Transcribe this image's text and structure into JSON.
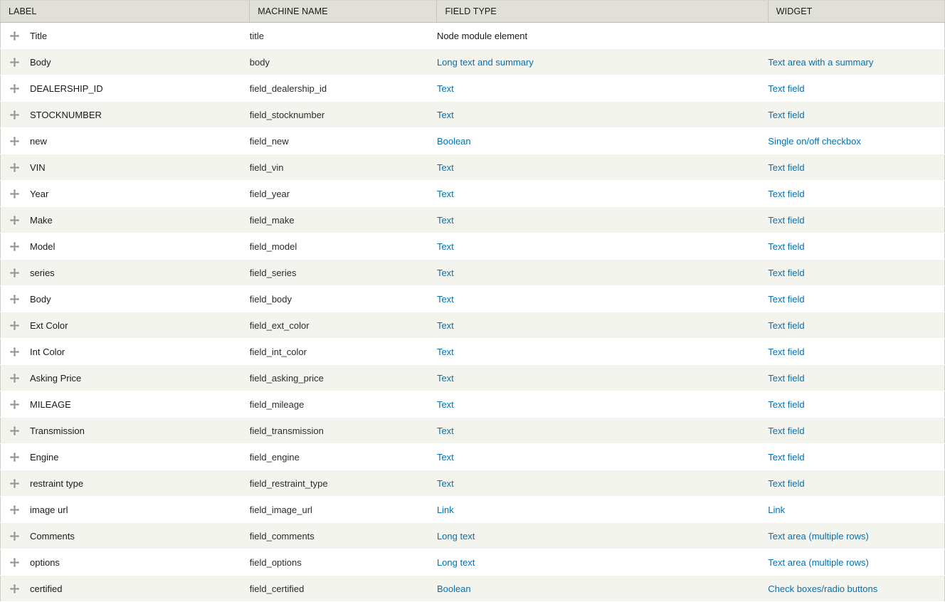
{
  "colors": {
    "header_bg": "#e0e0d9",
    "row_odd_bg": "#ffffff",
    "row_even_bg": "#f4f4ef",
    "link": "#0071b3",
    "text": "#1a1a1a",
    "border": "#c5c5bd"
  },
  "table": {
    "name": "manage-fields-table",
    "columns": [
      {
        "key": "label",
        "header": "LABEL"
      },
      {
        "key": "machine",
        "header": "MACHINE NAME"
      },
      {
        "key": "type",
        "header": "FIELD TYPE"
      },
      {
        "key": "widget",
        "header": "WIDGET"
      }
    ],
    "drag_icon": "move-cross-icon",
    "rows": [
      {
        "label": "Title",
        "machine_name": "title",
        "field_type": "Node module element",
        "field_type_is_link": false,
        "widget": "",
        "widget_is_link": false
      },
      {
        "label": "Body",
        "machine_name": "body",
        "field_type": "Long text and summary",
        "field_type_is_link": true,
        "widget": "Text area with a summary",
        "widget_is_link": true
      },
      {
        "label": "DEALERSHIP_ID",
        "machine_name": "field_dealership_id",
        "field_type": "Text",
        "field_type_is_link": true,
        "widget": "Text field",
        "widget_is_link": true
      },
      {
        "label": "STOCKNUMBER",
        "machine_name": "field_stocknumber",
        "field_type": "Text",
        "field_type_is_link": true,
        "widget": "Text field",
        "widget_is_link": true
      },
      {
        "label": "new",
        "machine_name": "field_new",
        "field_type": "Boolean",
        "field_type_is_link": true,
        "widget": "Single on/off checkbox",
        "widget_is_link": true
      },
      {
        "label": "VIN",
        "machine_name": "field_vin",
        "field_type": "Text",
        "field_type_is_link": true,
        "widget": "Text field",
        "widget_is_link": true
      },
      {
        "label": "Year",
        "machine_name": "field_year",
        "field_type": "Text",
        "field_type_is_link": true,
        "widget": "Text field",
        "widget_is_link": true
      },
      {
        "label": "Make",
        "machine_name": "field_make",
        "field_type": "Text",
        "field_type_is_link": true,
        "widget": "Text field",
        "widget_is_link": true
      },
      {
        "label": "Model",
        "machine_name": "field_model",
        "field_type": "Text",
        "field_type_is_link": true,
        "widget": "Text field",
        "widget_is_link": true
      },
      {
        "label": "series",
        "machine_name": "field_series",
        "field_type": "Text",
        "field_type_is_link": true,
        "widget": "Text field",
        "widget_is_link": true
      },
      {
        "label": "Body",
        "machine_name": "field_body",
        "field_type": "Text",
        "field_type_is_link": true,
        "widget": "Text field",
        "widget_is_link": true
      },
      {
        "label": "Ext Color",
        "machine_name": "field_ext_color",
        "field_type": "Text",
        "field_type_is_link": true,
        "widget": "Text field",
        "widget_is_link": true
      },
      {
        "label": "Int Color",
        "machine_name": "field_int_color",
        "field_type": "Text",
        "field_type_is_link": true,
        "widget": "Text field",
        "widget_is_link": true
      },
      {
        "label": "Asking Price",
        "machine_name": "field_asking_price",
        "field_type": "Text",
        "field_type_is_link": true,
        "widget": "Text field",
        "widget_is_link": true
      },
      {
        "label": "MILEAGE",
        "machine_name": "field_mileage",
        "field_type": "Text",
        "field_type_is_link": true,
        "widget": "Text field",
        "widget_is_link": true
      },
      {
        "label": "Transmission",
        "machine_name": "field_transmission",
        "field_type": "Text",
        "field_type_is_link": true,
        "widget": "Text field",
        "widget_is_link": true
      },
      {
        "label": "Engine",
        "machine_name": "field_engine",
        "field_type": "Text",
        "field_type_is_link": true,
        "widget": "Text field",
        "widget_is_link": true
      },
      {
        "label": "restraint type",
        "machine_name": "field_restraint_type",
        "field_type": "Text",
        "field_type_is_link": true,
        "widget": "Text field",
        "widget_is_link": true
      },
      {
        "label": "image url",
        "machine_name": "field_image_url",
        "field_type": "Link",
        "field_type_is_link": true,
        "widget": "Link",
        "widget_is_link": true
      },
      {
        "label": "Comments",
        "machine_name": "field_comments",
        "field_type": "Long text",
        "field_type_is_link": true,
        "widget": "Text area (multiple rows)",
        "widget_is_link": true
      },
      {
        "label": "options",
        "machine_name": "field_options",
        "field_type": "Long text",
        "field_type_is_link": true,
        "widget": "Text area (multiple rows)",
        "widget_is_link": true
      },
      {
        "label": "certified",
        "machine_name": "field_certified",
        "field_type": "Boolean",
        "field_type_is_link": true,
        "widget": "Check boxes/radio buttons",
        "widget_is_link": true
      }
    ]
  }
}
